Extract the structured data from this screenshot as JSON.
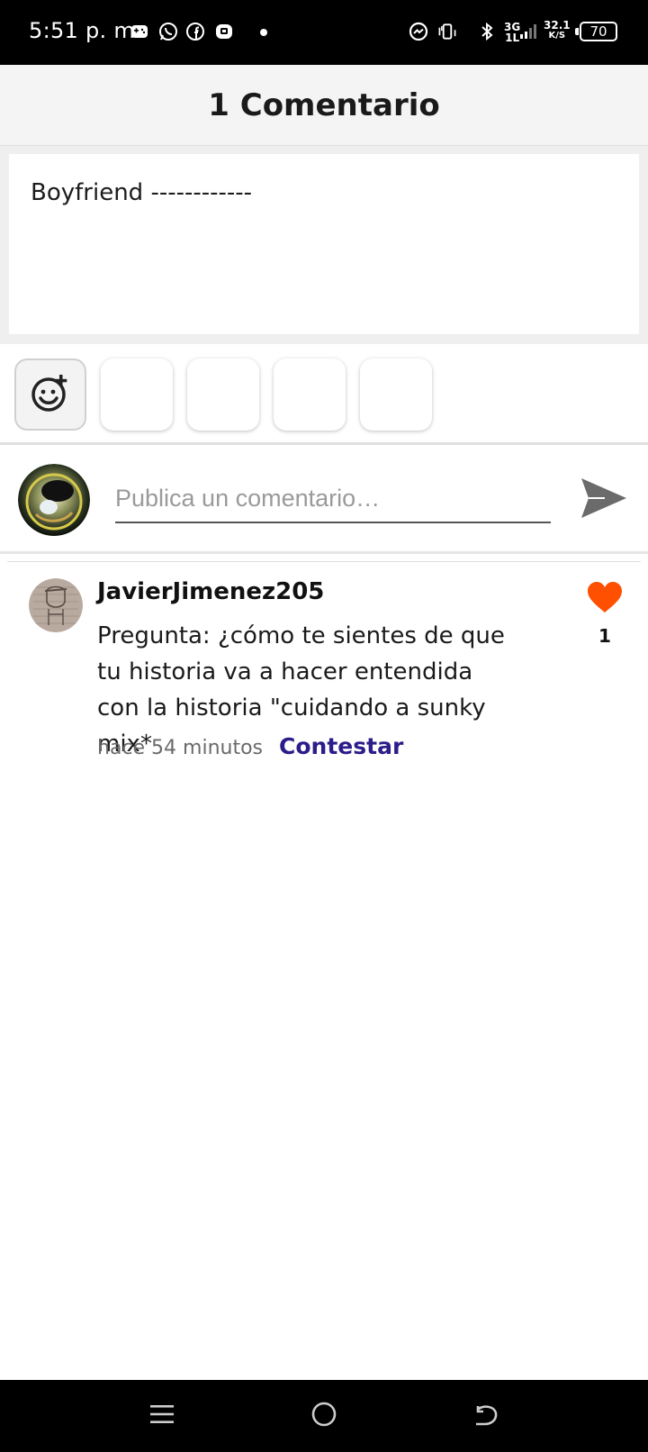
{
  "status_bar": {
    "time": "5:51 p. m.",
    "network_type": "3G",
    "network_sub": "1L",
    "speed_value": "32.1",
    "speed_unit": "K/S",
    "battery": "70",
    "left_icons": [
      "gamepad-icon",
      "whatsapp-icon",
      "facebook-icon",
      "messenger-icon"
    ],
    "right_icons": [
      "messenger-bubble-icon",
      "vibrate-icon",
      "bluetooth-icon",
      "signal-icon"
    ]
  },
  "header": {
    "title": "1 Comentario"
  },
  "compose": {
    "text": "Boyfriend ------------"
  },
  "sticker_bar": {
    "emoji_button_icon": "add-emoji-icon",
    "sticker_slots": 4
  },
  "comment_input": {
    "placeholder": "Publica un comentario…",
    "value": "",
    "send_icon": "send-icon"
  },
  "comments": [
    {
      "username": "JavierJimenez205",
      "text": "Pregunta: ¿cómo te sientes de que tu historia va a hacer entendida con la historia \"cuidando a sunky mix*",
      "time": "hace 54 minutos",
      "reply_label": "Contestar",
      "likes": "1",
      "like_icon": "heart-icon"
    }
  ],
  "colors": {
    "heart": "#ff4f00",
    "reply_link": "#2b1d8a",
    "header_bg": "#f4f4f4"
  },
  "nav_bar": {
    "icons": [
      "menu-icon",
      "home-icon",
      "back-icon"
    ]
  }
}
